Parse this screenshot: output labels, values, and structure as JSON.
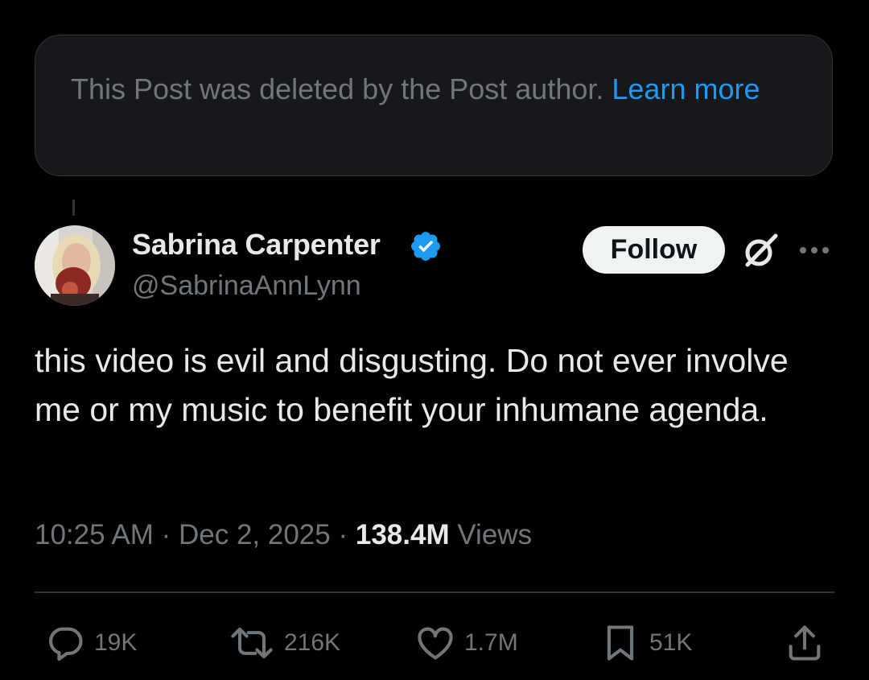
{
  "deleted_notice": {
    "text": "This Post was deleted by the Post author. ",
    "link": "Learn more"
  },
  "author": {
    "display_name": "Sabrina Carpenter",
    "handle": "@SabrinaAnnLynn",
    "verified_icon": "verified-badge-icon"
  },
  "header_actions": {
    "follow_label": "Follow",
    "grok_icon": "grok-icon",
    "more_icon": "more-options-icon"
  },
  "post": {
    "text": "this video is evil and disgusting. Do not ever involve me or my music to benefit your inhumane agenda."
  },
  "meta": {
    "time": "10:25 AM",
    "separator": " · ",
    "date": "Dec 2, 2025",
    "views_count": "138.4M",
    "views_label": " Views"
  },
  "actions": {
    "replies": "19K",
    "reposts": "216K",
    "likes": "1.7M",
    "bookmarks": "51K"
  },
  "colors": {
    "background": "#000000",
    "accent": "#1d9bf0",
    "primary_text": "#e7e9ea",
    "secondary_text": "#71767b",
    "card_background": "#16181c"
  }
}
